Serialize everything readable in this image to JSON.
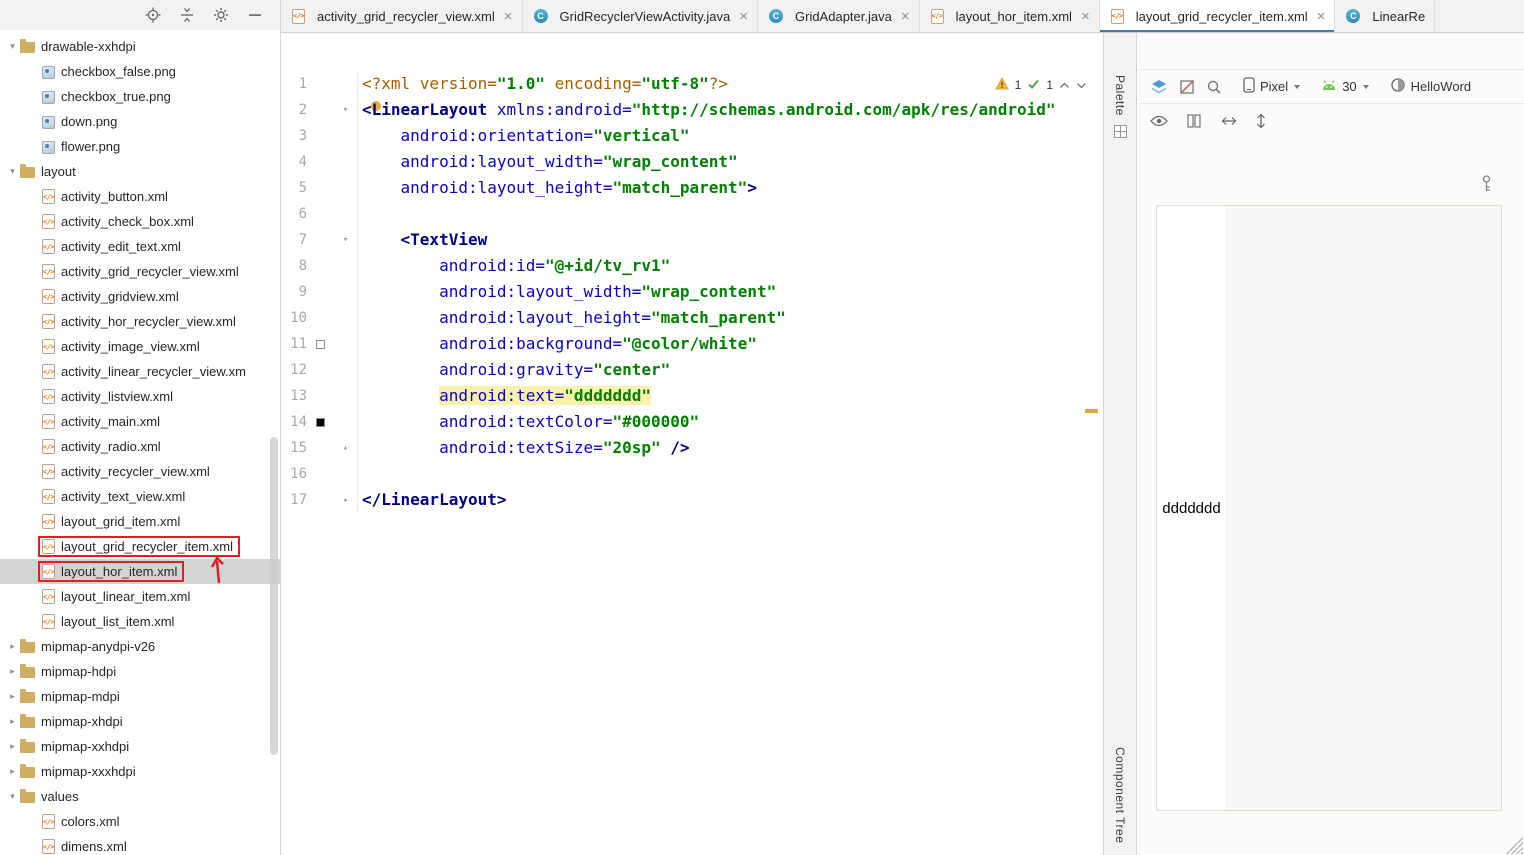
{
  "project_panel": {
    "toolbar_icons": [
      "locate-file",
      "collapse-all",
      "settings",
      "hide-panel"
    ],
    "tree": {
      "items": [
        {
          "label": "drawable-xxhdpi",
          "type": "folder",
          "level": 0,
          "expanded": true
        },
        {
          "label": "checkbox_false.png",
          "type": "image",
          "level": 1
        },
        {
          "label": "checkbox_true.png",
          "type": "image",
          "level": 1
        },
        {
          "label": "down.png",
          "type": "image",
          "level": 1
        },
        {
          "label": "flower.png",
          "type": "image",
          "level": 1
        },
        {
          "label": "layout",
          "type": "folder",
          "level": 0,
          "expanded": true
        },
        {
          "label": "activity_button.xml",
          "type": "xml",
          "level": 1
        },
        {
          "label": "activity_check_box.xml",
          "type": "xml",
          "level": 1
        },
        {
          "label": "activity_edit_text.xml",
          "type": "xml",
          "level": 1
        },
        {
          "label": "activity_grid_recycler_view.xml",
          "type": "xml",
          "level": 1
        },
        {
          "label": "activity_gridview.xml",
          "type": "xml",
          "level": 1
        },
        {
          "label": "activity_hor_recycler_view.xml",
          "type": "xml",
          "level": 1
        },
        {
          "label": "activity_image_view.xml",
          "type": "xml",
          "level": 1
        },
        {
          "label": "activity_linear_recycler_view.xm",
          "type": "xml",
          "level": 1
        },
        {
          "label": "activity_listview.xml",
          "type": "xml",
          "level": 1
        },
        {
          "label": "activity_main.xml",
          "type": "xml",
          "level": 1
        },
        {
          "label": "activity_radio.xml",
          "type": "xml",
          "level": 1
        },
        {
          "label": "activity_recycler_view.xml",
          "type": "xml",
          "level": 1
        },
        {
          "label": "activity_text_view.xml",
          "type": "xml",
          "level": 1
        },
        {
          "label": "layout_grid_item.xml",
          "type": "xml",
          "level": 1
        },
        {
          "label": "layout_grid_recycler_item.xml",
          "type": "xml",
          "level": 1,
          "annotated": true
        },
        {
          "label": "layout_hor_item.xml",
          "type": "xml",
          "level": 1,
          "annotated": true,
          "selected": true
        },
        {
          "label": "layout_linear_item.xml",
          "type": "xml",
          "level": 1
        },
        {
          "label": "layout_list_item.xml",
          "type": "xml",
          "level": 1
        },
        {
          "label": "mipmap-anydpi-v26",
          "type": "folder",
          "level": 0,
          "expanded": false
        },
        {
          "label": "mipmap-hdpi",
          "type": "folder",
          "level": 0,
          "expanded": false
        },
        {
          "label": "mipmap-mdpi",
          "type": "folder",
          "level": 0,
          "expanded": false
        },
        {
          "label": "mipmap-xhdpi",
          "type": "folder",
          "level": 0,
          "expanded": false
        },
        {
          "label": "mipmap-xxhdpi",
          "type": "folder",
          "level": 0,
          "expanded": false
        },
        {
          "label": "mipmap-xxxhdpi",
          "type": "folder",
          "level": 0,
          "expanded": false
        },
        {
          "label": "values",
          "type": "folder",
          "level": 0,
          "expanded": true
        },
        {
          "label": "colors.xml",
          "type": "xml",
          "level": 1
        },
        {
          "label": "dimens.xml",
          "type": "xml",
          "level": 1
        }
      ]
    }
  },
  "editor_tabs": [
    {
      "label": "activity_grid_recycler_view.xml",
      "icon": "xml",
      "close": true
    },
    {
      "label": "GridRecyclerViewActivity.java",
      "icon": "java",
      "close": true
    },
    {
      "label": "GridAdapter.java",
      "icon": "java",
      "close": true
    },
    {
      "label": "layout_hor_item.xml",
      "icon": "xml",
      "close": true
    },
    {
      "label": "layout_grid_recycler_item.xml",
      "icon": "xml",
      "close": true,
      "active": true
    },
    {
      "label": "LinearRe",
      "icon": "java",
      "close": false
    }
  ],
  "editor": {
    "inspections": {
      "warning_count": "1",
      "ok_count": "1"
    },
    "lines": [
      {
        "n": 1,
        "tokens": [
          {
            "c": "pi",
            "t": "<?xml version="
          },
          {
            "c": "val",
            "t": "\"1.0\""
          },
          {
            "c": "pi",
            "t": " encoding="
          },
          {
            "c": "val",
            "t": "\"utf-8\""
          },
          {
            "c": "pi",
            "t": "?>"
          }
        ]
      },
      {
        "n": 2,
        "fold": "down",
        "tokens": [
          {
            "c": "tag",
            "t": "<LinearLayout "
          },
          {
            "c": "attr",
            "t": "xmlns:android="
          },
          {
            "c": "val",
            "t": "\"http://schemas.android.com/apk/res/android\""
          }
        ]
      },
      {
        "n": 3,
        "tokens": [
          {
            "c": "plain",
            "t": "    "
          },
          {
            "c": "attr",
            "t": "android:orientation="
          },
          {
            "c": "val",
            "t": "\"vertical\""
          }
        ]
      },
      {
        "n": 4,
        "tokens": [
          {
            "c": "plain",
            "t": "    "
          },
          {
            "c": "attr",
            "t": "android:layout_width="
          },
          {
            "c": "val",
            "t": "\"wrap_content\""
          }
        ]
      },
      {
        "n": 5,
        "tokens": [
          {
            "c": "plain",
            "t": "    "
          },
          {
            "c": "attr",
            "t": "android:layout_height="
          },
          {
            "c": "val",
            "t": "\"match_parent\""
          },
          {
            "c": "tag",
            "t": ">"
          }
        ]
      },
      {
        "n": 6,
        "tokens": []
      },
      {
        "n": 7,
        "fold": "down",
        "tokens": [
          {
            "c": "plain",
            "t": "    "
          },
          {
            "c": "tag",
            "t": "<TextView"
          }
        ]
      },
      {
        "n": 8,
        "tokens": [
          {
            "c": "plain",
            "t": "        "
          },
          {
            "c": "attr",
            "t": "android:id="
          },
          {
            "c": "val",
            "t": "\"@+id/tv_rv1\""
          }
        ]
      },
      {
        "n": 9,
        "tokens": [
          {
            "c": "plain",
            "t": "        "
          },
          {
            "c": "attr",
            "t": "android:layout_width="
          },
          {
            "c": "val",
            "t": "\"wrap_content\""
          }
        ]
      },
      {
        "n": 10,
        "tokens": [
          {
            "c": "plain",
            "t": "        "
          },
          {
            "c": "attr",
            "t": "android:layout_height="
          },
          {
            "c": "val",
            "t": "\"match_parent\""
          }
        ]
      },
      {
        "n": 11,
        "chip": "#ffffff",
        "tokens": [
          {
            "c": "plain",
            "t": "        "
          },
          {
            "c": "attr",
            "t": "android:background="
          },
          {
            "c": "val",
            "t": "\"@color/white\""
          }
        ]
      },
      {
        "n": 12,
        "tokens": [
          {
            "c": "plain",
            "t": "        "
          },
          {
            "c": "attr",
            "t": "android:gravity="
          },
          {
            "c": "val",
            "t": "\"center\""
          }
        ]
      },
      {
        "n": 13,
        "tokens": [
          {
            "c": "plain",
            "t": "        "
          },
          {
            "c": "attr",
            "t": "android:text=",
            "h": true
          },
          {
            "c": "val",
            "t": "\"ddddddd\"",
            "h": true
          }
        ]
      },
      {
        "n": 14,
        "chip": "#000000",
        "tokens": [
          {
            "c": "plain",
            "t": "        "
          },
          {
            "c": "attr",
            "t": "android:textColor="
          },
          {
            "c": "val",
            "t": "\"#000000\""
          }
        ]
      },
      {
        "n": 15,
        "fold": "up",
        "tokens": [
          {
            "c": "plain",
            "t": "        "
          },
          {
            "c": "attr",
            "t": "android:textSize="
          },
          {
            "c": "val",
            "t": "\"20sp\""
          },
          {
            "c": "plain",
            "t": " "
          },
          {
            "c": "tag",
            "t": "/>"
          }
        ]
      },
      {
        "n": 16,
        "tokens": []
      },
      {
        "n": 17,
        "fold": "up",
        "tokens": [
          {
            "c": "tag",
            "t": "</LinearLayout>"
          }
        ]
      }
    ]
  },
  "preview": {
    "palette_label": "Palette",
    "component_tree_label": "Component Tree",
    "device": "Pixel",
    "api_level": "30",
    "theme": "HelloWord",
    "canvas_text": "ddddddd"
  }
}
